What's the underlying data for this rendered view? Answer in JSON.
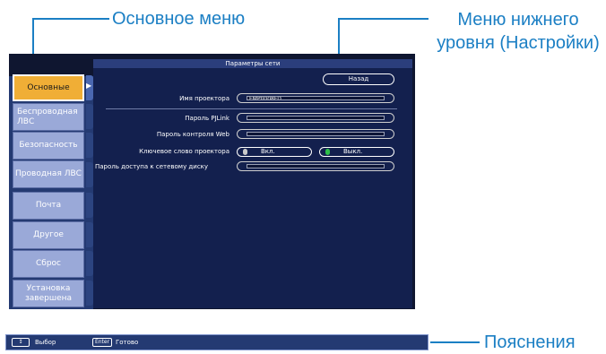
{
  "callouts": {
    "main_menu": "Основное меню",
    "submenu": "Меню нижнего уровня (Настройки)",
    "help": "Пояснения"
  },
  "window": {
    "title": "Параметры сети",
    "back_button": "Назад"
  },
  "sidebar": {
    "items": [
      {
        "label": "Основные",
        "active": true
      },
      {
        "label": "Беспроводная ЛВС",
        "active": false
      },
      {
        "label": "Безопасность",
        "active": false
      },
      {
        "label": "Проводная ЛВС",
        "active": false
      },
      {
        "label": "Почта",
        "active": false
      },
      {
        "label": "Другое",
        "active": false
      },
      {
        "label": "Сброс",
        "active": false
      },
      {
        "label": "Установка завершена",
        "active": false
      }
    ]
  },
  "form": {
    "projector_name": {
      "label": "Имя проектора",
      "value": "EMP0008FD"
    },
    "pjlink_password": {
      "label": "Пароль PJLink",
      "value": ""
    },
    "web_password": {
      "label": "Пароль контроля Web",
      "value": ""
    },
    "keyword": {
      "label": "Ключевое слово проектора",
      "on": "Вкл.",
      "off": "Выкл.",
      "selected": "off"
    },
    "network_drive_password": {
      "label": "Пароль доступа к сетевому диску",
      "value": ""
    }
  },
  "helpbar": {
    "select_key": "↕",
    "select_label": "Выбор",
    "enter_key": "Enter",
    "enter_label": "Готово"
  },
  "colors": {
    "callout": "#1b7fc4",
    "active_tab": "#f0ae36",
    "panel": "#13204e",
    "radio_on_dot": "#c9c9c9",
    "radio_off_dot": "#2fbf4a"
  }
}
